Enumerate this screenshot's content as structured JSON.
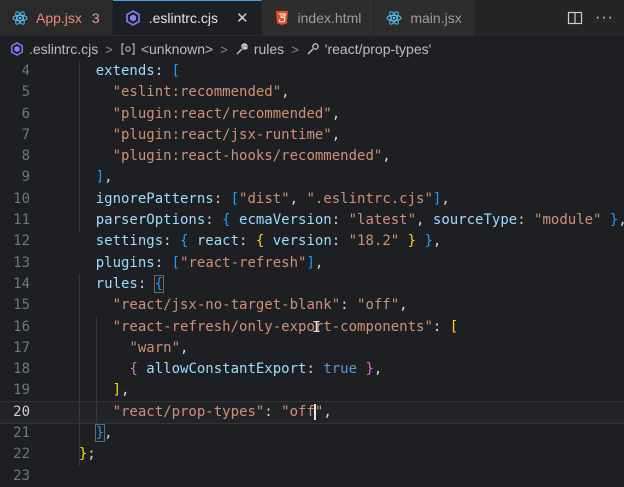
{
  "tabs": [
    {
      "icon": "react-icon",
      "label": "App.jsx",
      "badge": "3"
    },
    {
      "icon": "eslint-icon",
      "label": ".eslintrc.cjs",
      "close": "✕"
    },
    {
      "icon": "html5-icon",
      "label": "index.html"
    },
    {
      "icon": "react-icon",
      "label": "main.jsx"
    }
  ],
  "breadcrumb": [
    {
      "icon": "eslint-icon",
      "label": ".eslintrc.cjs"
    },
    {
      "icon": "bracket-icon",
      "label": "<unknown>"
    },
    {
      "icon": "wrench-icon",
      "label": "rules"
    },
    {
      "icon": "wrench-icon",
      "label": "'react/prop-types'"
    }
  ],
  "colors": {
    "accent": "#3c9cf0",
    "error_tab": "#f08a7e"
  },
  "editor": {
    "current_line": "20",
    "lines": [
      {
        "n": "4",
        "t": [
          [
            "    ",
            "p"
          ],
          [
            "extends",
            "k"
          ],
          [
            ": ",
            "p"
          ],
          [
            "[",
            "b2"
          ]
        ]
      },
      {
        "n": "5",
        "t": [
          [
            "      ",
            "p"
          ],
          [
            "\"eslint:recommended\"",
            "s"
          ],
          [
            ",",
            "p"
          ]
        ]
      },
      {
        "n": "6",
        "t": [
          [
            "      ",
            "p"
          ],
          [
            "\"plugin:react/recommended\"",
            "s"
          ],
          [
            ",",
            "p"
          ]
        ]
      },
      {
        "n": "7",
        "t": [
          [
            "      ",
            "p"
          ],
          [
            "\"plugin:react/jsx-runtime\"",
            "s"
          ],
          [
            ",",
            "p"
          ]
        ]
      },
      {
        "n": "8",
        "t": [
          [
            "      ",
            "p"
          ],
          [
            "\"plugin:react-hooks/recommended\"",
            "s"
          ],
          [
            ",",
            "p"
          ]
        ]
      },
      {
        "n": "9",
        "t": [
          [
            "    ",
            "p"
          ],
          [
            "]",
            "b2"
          ],
          [
            ",",
            "p"
          ]
        ]
      },
      {
        "n": "10",
        "t": [
          [
            "    ",
            "p"
          ],
          [
            "ignorePatterns",
            "k"
          ],
          [
            ": ",
            "p"
          ],
          [
            "[",
            "b2"
          ],
          [
            "\"dist\"",
            "s"
          ],
          [
            ", ",
            "p"
          ],
          [
            "\".eslintrc.cjs\"",
            "s"
          ],
          [
            "]",
            "b2"
          ],
          [
            ",",
            "p"
          ]
        ]
      },
      {
        "n": "11",
        "t": [
          [
            "    ",
            "p"
          ],
          [
            "parserOptions",
            "k"
          ],
          [
            ": ",
            "p"
          ],
          [
            "{ ",
            "b2"
          ],
          [
            "ecmaVersion",
            "k"
          ],
          [
            ": ",
            "p"
          ],
          [
            "\"latest\"",
            "s"
          ],
          [
            ", ",
            "p"
          ],
          [
            "sourceType",
            "k"
          ],
          [
            ": ",
            "p"
          ],
          [
            "\"module\"",
            "s"
          ],
          [
            " }",
            "b2"
          ],
          [
            ",",
            "p"
          ]
        ]
      },
      {
        "n": "12",
        "t": [
          [
            "    ",
            "p"
          ],
          [
            "settings",
            "k"
          ],
          [
            ": ",
            "p"
          ],
          [
            "{ ",
            "b2"
          ],
          [
            "react",
            "k"
          ],
          [
            ": ",
            "p"
          ],
          [
            "{ ",
            "b3"
          ],
          [
            "version",
            "k"
          ],
          [
            ": ",
            "p"
          ],
          [
            "\"18.2\"",
            "s"
          ],
          [
            " }",
            "b3"
          ],
          [
            " }",
            "b2"
          ],
          [
            ",",
            "p"
          ]
        ]
      },
      {
        "n": "13",
        "t": [
          [
            "    ",
            "p"
          ],
          [
            "plugins",
            "k"
          ],
          [
            ": ",
            "p"
          ],
          [
            "[",
            "b2"
          ],
          [
            "\"react-refresh\"",
            "s"
          ],
          [
            "]",
            "b2"
          ],
          [
            ",",
            "p"
          ]
        ]
      },
      {
        "n": "14",
        "t": [
          [
            "    ",
            "p"
          ],
          [
            "rules",
            "k"
          ],
          [
            ": ",
            "p"
          ],
          [
            "{",
            "b2bh"
          ]
        ]
      },
      {
        "n": "15",
        "t": [
          [
            "      ",
            "p"
          ],
          [
            "\"react/jsx-no-target-blank\"",
            "s"
          ],
          [
            ": ",
            "p"
          ],
          [
            "\"off\"",
            "s"
          ],
          [
            ",",
            "p"
          ]
        ]
      },
      {
        "n": "16",
        "t": [
          [
            "      ",
            "p"
          ],
          [
            "\"react-refresh/only-export-components\"",
            "s"
          ],
          [
            ": ",
            "p"
          ],
          [
            "[",
            "b3"
          ]
        ]
      },
      {
        "n": "17",
        "t": [
          [
            "        ",
            "p"
          ],
          [
            "\"warn\"",
            "s"
          ],
          [
            ",",
            "p"
          ]
        ]
      },
      {
        "n": "18",
        "t": [
          [
            "        ",
            "p"
          ],
          [
            "{ ",
            "b1"
          ],
          [
            "allowConstantExport",
            "k"
          ],
          [
            ": ",
            "p"
          ],
          [
            "true",
            "kw"
          ],
          [
            " }",
            "b1"
          ],
          [
            ",",
            "p"
          ]
        ]
      },
      {
        "n": "19",
        "t": [
          [
            "      ",
            "p"
          ],
          [
            "]",
            "b3"
          ],
          [
            ",",
            "p"
          ]
        ]
      },
      {
        "n": "20",
        "t": [
          [
            "      ",
            "p"
          ],
          [
            "\"react/prop-types\"",
            "s"
          ],
          [
            ": ",
            "p"
          ],
          [
            "\"off",
            "s"
          ],
          [
            "|",
            "cursor"
          ],
          [
            "\"",
            "s"
          ],
          [
            ",",
            "p"
          ]
        ]
      },
      {
        "n": "21",
        "t": [
          [
            "    ",
            "p"
          ],
          [
            "}",
            "b2bh"
          ],
          [
            ",",
            "p"
          ]
        ]
      },
      {
        "n": "22",
        "t": [
          [
            "  ",
            "p"
          ],
          [
            "}",
            "b3"
          ],
          [
            ";",
            "p"
          ]
        ]
      },
      {
        "n": "23",
        "t": []
      }
    ]
  }
}
